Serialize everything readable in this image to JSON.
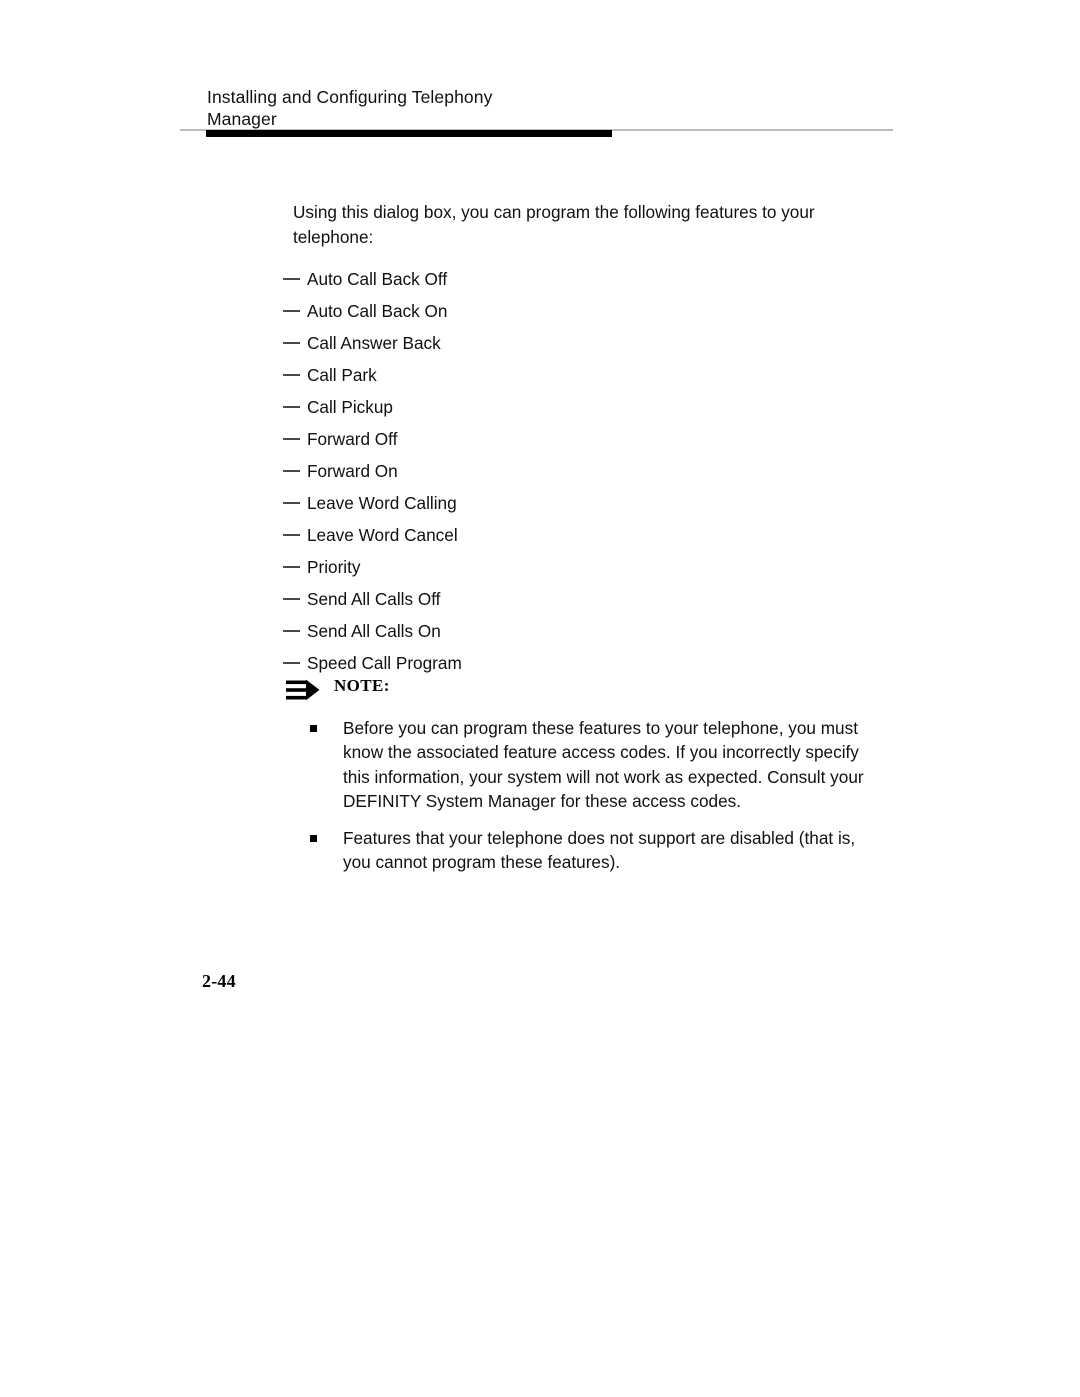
{
  "header": {
    "line1": "Installing and Configuring Telephony",
    "line2": "Manager"
  },
  "main": {
    "intro": "Using this dialog box, you can program the following features to your telephone:",
    "features": [
      "Auto Call Back Off",
      "Auto Call Back On",
      "Call Answer Back",
      "Call Park",
      "Call Pickup",
      "Forward Off",
      "Forward On",
      "Leave Word Calling",
      "Leave Word Cancel",
      "Priority",
      "Send All Calls Off",
      "Send All Calls On",
      "Speed Call Program"
    ]
  },
  "note": {
    "label": "NOTE:",
    "icon": "pencil-pointer-icon",
    "items": [
      "Before you can program these features to your telephone, you must know the associated feature access codes. If you incorrectly specify this information, your system will not work as expected. Consult your DEFINITY System Manager for these access codes.",
      "Features that your telephone does not support are disabled (that is, you cannot program these features)."
    ]
  },
  "footer": {
    "page_number": "2-44"
  },
  "colors": {
    "text": "#111111",
    "rule_dark": "#000000",
    "rule_light": "#bdbdbd",
    "dash": "#4a4a4a"
  }
}
